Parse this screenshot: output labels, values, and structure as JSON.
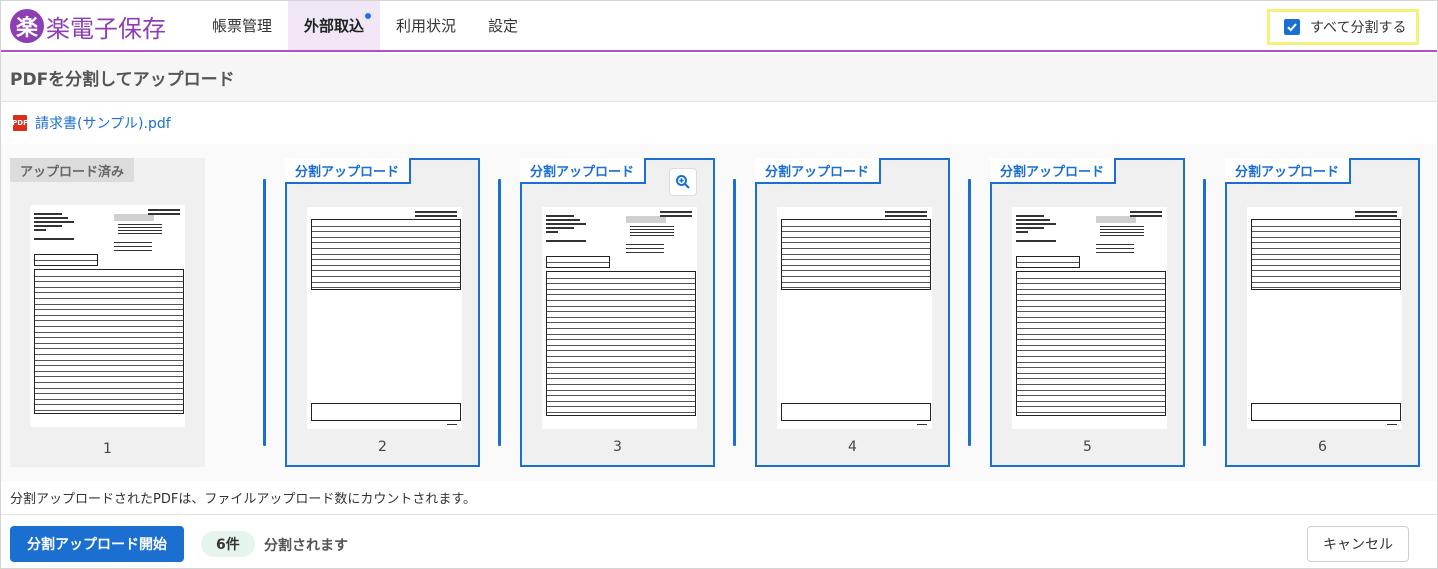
{
  "app": {
    "logo_mark": "楽",
    "logo_text": "楽電子保存"
  },
  "nav": {
    "items": [
      {
        "label": "帳票管理"
      },
      {
        "label": "外部取込"
      },
      {
        "label": "利用状況"
      },
      {
        "label": "設定"
      }
    ],
    "active_index": 1
  },
  "split_all": {
    "label": "すべて分割する",
    "checked": true
  },
  "page": {
    "title": "PDFを分割してアップロード"
  },
  "file": {
    "icon_text": "PDF",
    "name": "請求書(サンプル).pdf"
  },
  "cards": [
    {
      "label": "アップロード済み",
      "number": "1",
      "type": "uploaded",
      "layout": "header"
    },
    {
      "label": "分割アップロード",
      "number": "2",
      "type": "split",
      "layout": "continuation"
    },
    {
      "label": "分割アップロード",
      "number": "3",
      "type": "split",
      "layout": "header",
      "zoom": true
    },
    {
      "label": "分割アップロード",
      "number": "4",
      "type": "split",
      "layout": "continuation"
    },
    {
      "label": "分割アップロード",
      "number": "5",
      "type": "split",
      "layout": "header"
    },
    {
      "label": "分割アップロード",
      "number": "6",
      "type": "split",
      "layout": "continuation"
    }
  ],
  "note": "分割アップロードされたPDFは、ファイルアップロード数にカウントされます。",
  "footer": {
    "start_label": "分割アップロード開始",
    "count_badge": "6件",
    "count_text": "分割されます",
    "cancel_label": "キャンセル"
  },
  "colors": {
    "brand": "#8e3db5",
    "accent": "#1a6fd0",
    "highlight": "#f5f27a"
  },
  "icons": {
    "split_all": "checkbox-checked-icon",
    "file": "pdf-file-icon",
    "zoom": "zoom-in-icon"
  }
}
